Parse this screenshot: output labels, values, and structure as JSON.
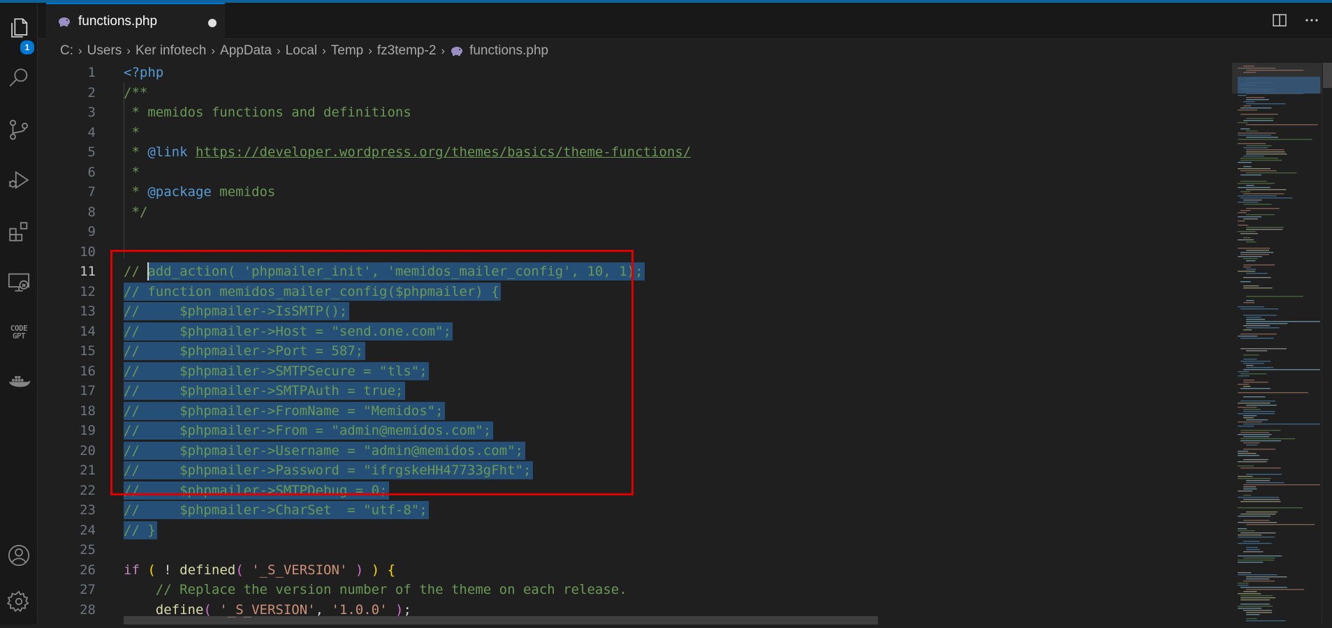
{
  "tab": {
    "filename": "functions.php",
    "dirty": true
  },
  "activity": {
    "explorer_badge": "1",
    "codegpt_line1": "CODE",
    "codegpt_line2": "GPT"
  },
  "breadcrumb": [
    "C:",
    "Users",
    "Ker infotech",
    "AppData",
    "Local",
    "Temp",
    "fz3temp-2",
    "functions.php"
  ],
  "colors": {
    "accent": "#0078d4",
    "selection": "#264f78",
    "highlight_box": "#e00000",
    "comment": "#6a9955",
    "string": "#ce9178",
    "keyword": "#569cd6"
  },
  "lines": [
    {
      "n": "1",
      "segs": [
        [
          "tag",
          "<?php"
        ]
      ]
    },
    {
      "n": "2",
      "segs": [
        [
          "cm",
          "/**"
        ]
      ]
    },
    {
      "n": "3",
      "segs": [
        [
          "cm",
          " * memidos functions and definitions"
        ]
      ]
    },
    {
      "n": "4",
      "segs": [
        [
          "cm",
          " *"
        ]
      ]
    },
    {
      "n": "5",
      "segs": [
        [
          "cm",
          " * "
        ],
        [
          "doc",
          "@link"
        ],
        [
          "cm",
          " "
        ],
        [
          "lnk",
          "https://developer.wordpress.org/themes/basics/theme-functions/"
        ]
      ]
    },
    {
      "n": "6",
      "segs": [
        [
          "cm",
          " *"
        ]
      ]
    },
    {
      "n": "7",
      "segs": [
        [
          "cm",
          " * "
        ],
        [
          "doc",
          "@package"
        ],
        [
          "cm",
          " memidos"
        ]
      ]
    },
    {
      "n": "8",
      "segs": [
        [
          "cm",
          " */"
        ]
      ]
    },
    {
      "n": "9",
      "segs": []
    },
    {
      "n": "10",
      "segs": []
    },
    {
      "n": "11",
      "active": true,
      "sel": true,
      "segs": [
        [
          "cm",
          "// add_action( 'phpmailer_init', 'memidos_mailer_config', 10, 1);"
        ]
      ]
    },
    {
      "n": "12",
      "sel": true,
      "segs": [
        [
          "cm",
          "// function memidos_mailer_config($phpmailer) {"
        ]
      ]
    },
    {
      "n": "13",
      "sel": true,
      "segs": [
        [
          "cm",
          "//     $phpmailer->IsSMTP();"
        ]
      ]
    },
    {
      "n": "14",
      "sel": true,
      "segs": [
        [
          "cm",
          "//     $phpmailer->Host = \"send.one.com\";"
        ]
      ]
    },
    {
      "n": "15",
      "sel": true,
      "segs": [
        [
          "cm",
          "//     $phpmailer->Port = 587;"
        ]
      ]
    },
    {
      "n": "16",
      "sel": true,
      "segs": [
        [
          "cm",
          "//     $phpmailer->SMTPSecure = \"tls\";"
        ]
      ]
    },
    {
      "n": "17",
      "sel": true,
      "segs": [
        [
          "cm",
          "//     $phpmailer->SMTPAuth = true;"
        ]
      ]
    },
    {
      "n": "18",
      "sel": true,
      "segs": [
        [
          "cm",
          "//     $phpmailer->FromName = \"Memidos\";"
        ]
      ]
    },
    {
      "n": "19",
      "sel": true,
      "segs": [
        [
          "cm",
          "//     $phpmailer->From = \"admin@memidos.com\";"
        ]
      ]
    },
    {
      "n": "20",
      "sel": true,
      "segs": [
        [
          "cm",
          "//     $phpmailer->Username = \"admin@memidos.com\";"
        ]
      ]
    },
    {
      "n": "21",
      "sel": true,
      "segs": [
        [
          "cm",
          "//     $phpmailer->Password = \"ifrgskeHH47733gFht\";"
        ]
      ]
    },
    {
      "n": "22",
      "sel": true,
      "segs": [
        [
          "cm",
          "//     $phpmailer->SMTPDebug = 0;"
        ]
      ]
    },
    {
      "n": "23",
      "sel": true,
      "segs": [
        [
          "cm",
          "//     $phpmailer->CharSet  = \"utf-8\";"
        ]
      ]
    },
    {
      "n": "24",
      "sel": true,
      "segs": [
        [
          "cm",
          "// }"
        ]
      ]
    },
    {
      "n": "25",
      "segs": []
    },
    {
      "n": "26",
      "segs": [
        [
          "kw",
          "if"
        ],
        [
          "pun",
          " "
        ],
        [
          "br1",
          "("
        ],
        [
          "pun",
          " ! "
        ],
        [
          "fn",
          "defined"
        ],
        [
          "br2",
          "("
        ],
        [
          "pun",
          " "
        ],
        [
          "str",
          "'_S_VERSION'"
        ],
        [
          "pun",
          " "
        ],
        [
          "br2",
          ")"
        ],
        [
          "pun",
          " "
        ],
        [
          "br1",
          ")"
        ],
        [
          "pun",
          " "
        ],
        [
          "br1",
          "{"
        ]
      ]
    },
    {
      "n": "27",
      "segs": [
        [
          "cm",
          "    // Replace the version number of the theme on each release."
        ]
      ]
    },
    {
      "n": "28",
      "segs": [
        [
          "pun",
          "    "
        ],
        [
          "fn",
          "define"
        ],
        [
          "br2",
          "("
        ],
        [
          "pun",
          " "
        ],
        [
          "str",
          "'_S_VERSION'"
        ],
        [
          "pun",
          ", "
        ],
        [
          "str",
          "'1.0.0'"
        ],
        [
          "pun",
          " "
        ],
        [
          "br2",
          ")"
        ],
        [
          "pun",
          ";"
        ]
      ]
    }
  ]
}
